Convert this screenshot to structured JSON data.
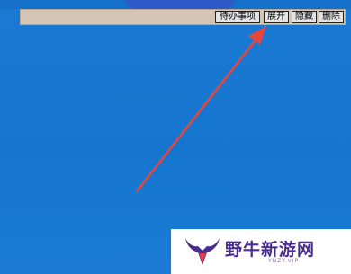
{
  "toolbar": {
    "todo_label": "待办事项",
    "expand_label": "展开",
    "hide_label": "隐藏",
    "delete_label": "删除"
  },
  "watermark": {
    "title": "野牛新游网",
    "url": "YNZY.VIP"
  },
  "colors": {
    "desktop": "#1878d0",
    "toolbar": "#d4c4b4",
    "arrow": "#e8453c",
    "brand": "#4a2d8c"
  },
  "icons": [
    "bull-logo-icon",
    "red-arrow-annotation"
  ]
}
